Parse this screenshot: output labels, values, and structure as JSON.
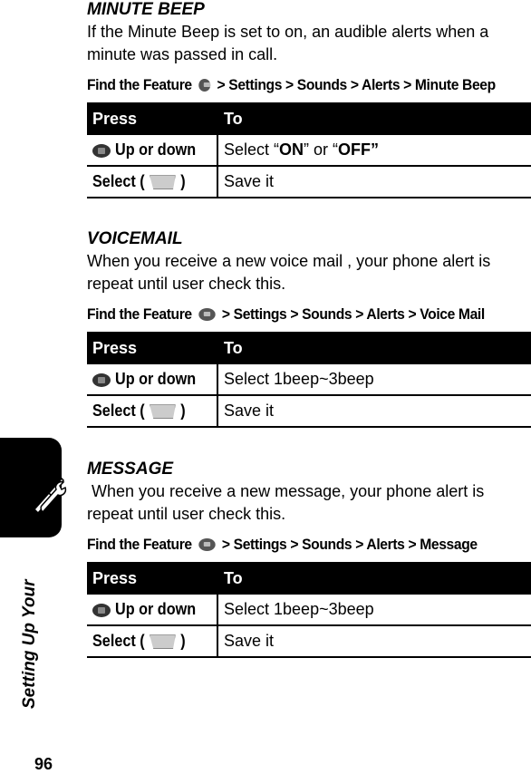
{
  "page": {
    "number": "96",
    "side_label": "Setting Up Your"
  },
  "sections": [
    {
      "title": "MINUTE BEEP",
      "body": "If the Minute Beep is set to on, an audible alerts when a minute was passed in call.",
      "path_prefix": "Find the Feature",
      "path": "> Settings > Sounds > Alerts > Minute Beep",
      "table": {
        "headers": [
          "Press",
          "To"
        ],
        "rows": [
          {
            "press": "Up or down",
            "to_pre": "Select “",
            "to_b1": "ON",
            "to_mid": "” or “",
            "to_b2": "OFF”"
          },
          {
            "press_pre": "Select (",
            "press_post": ")",
            "to": "Save it"
          }
        ]
      }
    },
    {
      "title": "VOICEMAIL",
      "body": "When you receive a new voice mail , your phone alert is repeat until user check this.",
      "path_prefix": "Find the Feature",
      "path": "> Settings > Sounds > Alerts > Voice Mail",
      "table": {
        "headers": [
          "Press",
          "To"
        ],
        "rows": [
          {
            "press": "Up or down",
            "to": "Select 1beep~3beep"
          },
          {
            "press_pre": "Select (",
            "press_post": ")",
            "to": "Save it"
          }
        ]
      }
    },
    {
      "title": "MESSAGE",
      "body": " When you receive a new message, your phone alert is repeat until user check this.",
      "path_prefix": "Find the Feature",
      "path": "> Settings > Sounds > Alerts > Message",
      "table": {
        "headers": [
          "Press",
          "To"
        ],
        "rows": [
          {
            "press": "Up or down",
            "to": "Select 1beep~3beep"
          },
          {
            "press_pre": "Select (",
            "press_post": ")",
            "to": "Save it"
          }
        ]
      }
    }
  ]
}
